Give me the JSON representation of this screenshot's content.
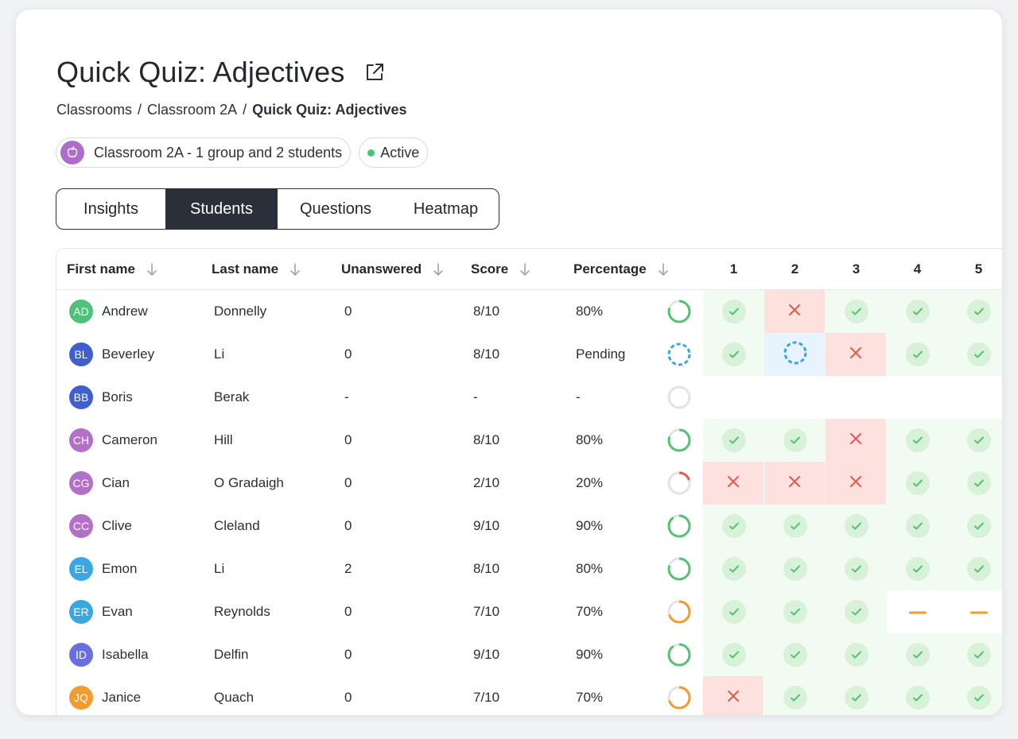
{
  "title": "Quick Quiz: Adjectives",
  "breadcrumb": [
    "Classrooms",
    "Classroom 2A",
    "Quick Quiz: Adjectives"
  ],
  "chips": {
    "classroom": "Classroom 2A - 1 group and 2 students",
    "status": "Active"
  },
  "tabs": [
    "Insights",
    "Students",
    "Questions",
    "Heatmap"
  ],
  "active_tab": "Students",
  "columns": {
    "first_name": "First name",
    "last_name": "Last name",
    "unanswered": "Unanswered",
    "score": "Score",
    "percentage": "Percentage",
    "questions": [
      "1",
      "2",
      "3",
      "4",
      "5"
    ]
  },
  "colors": {
    "green": "#56c274",
    "red": "#e05a4e",
    "orange": "#f29b2e",
    "blue": "#3aa6e2",
    "ring_track": "#e2e3e6"
  },
  "rows": [
    {
      "initials": "AD",
      "avatar_color": "#4fc27a",
      "first": "Andrew",
      "last": "Donnelly",
      "unanswered": "0",
      "score": "8/10",
      "percentage": "80%",
      "progress": 0.8,
      "ring": "green",
      "answers": [
        "correct",
        "wrong",
        "correct",
        "correct",
        "correct"
      ]
    },
    {
      "initials": "BL",
      "avatar_color": "#3f5fd1",
      "first": "Beverley",
      "last": "Li",
      "unanswered": "0",
      "score": "8/10",
      "percentage": "Pending",
      "progress": null,
      "ring": "pending",
      "answers": [
        "correct",
        "pending",
        "wrong",
        "correct",
        "correct"
      ]
    },
    {
      "initials": "BB",
      "avatar_color": "#3f5fd1",
      "first": "Boris",
      "last": "Berak",
      "unanswered": "-",
      "score": "-",
      "percentage": "-",
      "progress": 0,
      "ring": "empty",
      "answers": [
        "blank",
        "blank",
        "blank",
        "blank",
        "blank"
      ]
    },
    {
      "initials": "CH",
      "avatar_color": "#b270c8",
      "first": "Cameron",
      "last": "Hill",
      "unanswered": "0",
      "score": "8/10",
      "percentage": "80%",
      "progress": 0.8,
      "ring": "green",
      "answers": [
        "correct",
        "correct",
        "wrong",
        "correct",
        "correct"
      ]
    },
    {
      "initials": "CG",
      "avatar_color": "#b270c8",
      "first": "Cian",
      "last": "O Gradaigh",
      "unanswered": "0",
      "score": "2/10",
      "percentage": "20%",
      "progress": 0.2,
      "ring": "red",
      "answers": [
        "wrong",
        "wrong",
        "wrong",
        "correct",
        "correct"
      ]
    },
    {
      "initials": "CC",
      "avatar_color": "#b270c8",
      "first": "Clive",
      "last": "Cleland",
      "unanswered": "0",
      "score": "9/10",
      "percentage": "90%",
      "progress": 0.9,
      "ring": "green",
      "answers": [
        "correct",
        "correct",
        "correct",
        "correct",
        "correct"
      ]
    },
    {
      "initials": "EL",
      "avatar_color": "#3aa6e2",
      "first": "Emon",
      "last": "Li",
      "unanswered": "2",
      "score": "8/10",
      "percentage": "80%",
      "progress": 0.8,
      "ring": "green",
      "answers": [
        "correct",
        "correct",
        "correct",
        "correct",
        "correct"
      ]
    },
    {
      "initials": "ER",
      "avatar_color": "#3aa6e2",
      "first": "Evan",
      "last": "Reynolds",
      "unanswered": "0",
      "score": "7/10",
      "percentage": "70%",
      "progress": 0.7,
      "ring": "orange",
      "answers": [
        "correct",
        "correct",
        "correct",
        "unanswered",
        "unanswered"
      ]
    },
    {
      "initials": "ID",
      "avatar_color": "#6a6fe0",
      "first": "Isabella",
      "last": "Delfin",
      "unanswered": "0",
      "score": "9/10",
      "percentage": "90%",
      "progress": 0.9,
      "ring": "green",
      "answers": [
        "correct",
        "correct",
        "correct",
        "correct",
        "correct"
      ]
    },
    {
      "initials": "JQ",
      "avatar_color": "#f29b2e",
      "first": "Janice",
      "last": "Quach",
      "unanswered": "0",
      "score": "7/10",
      "percentage": "70%",
      "progress": 0.7,
      "ring": "orange",
      "answers": [
        "wrong",
        "correct",
        "correct",
        "correct",
        "correct"
      ]
    }
  ]
}
